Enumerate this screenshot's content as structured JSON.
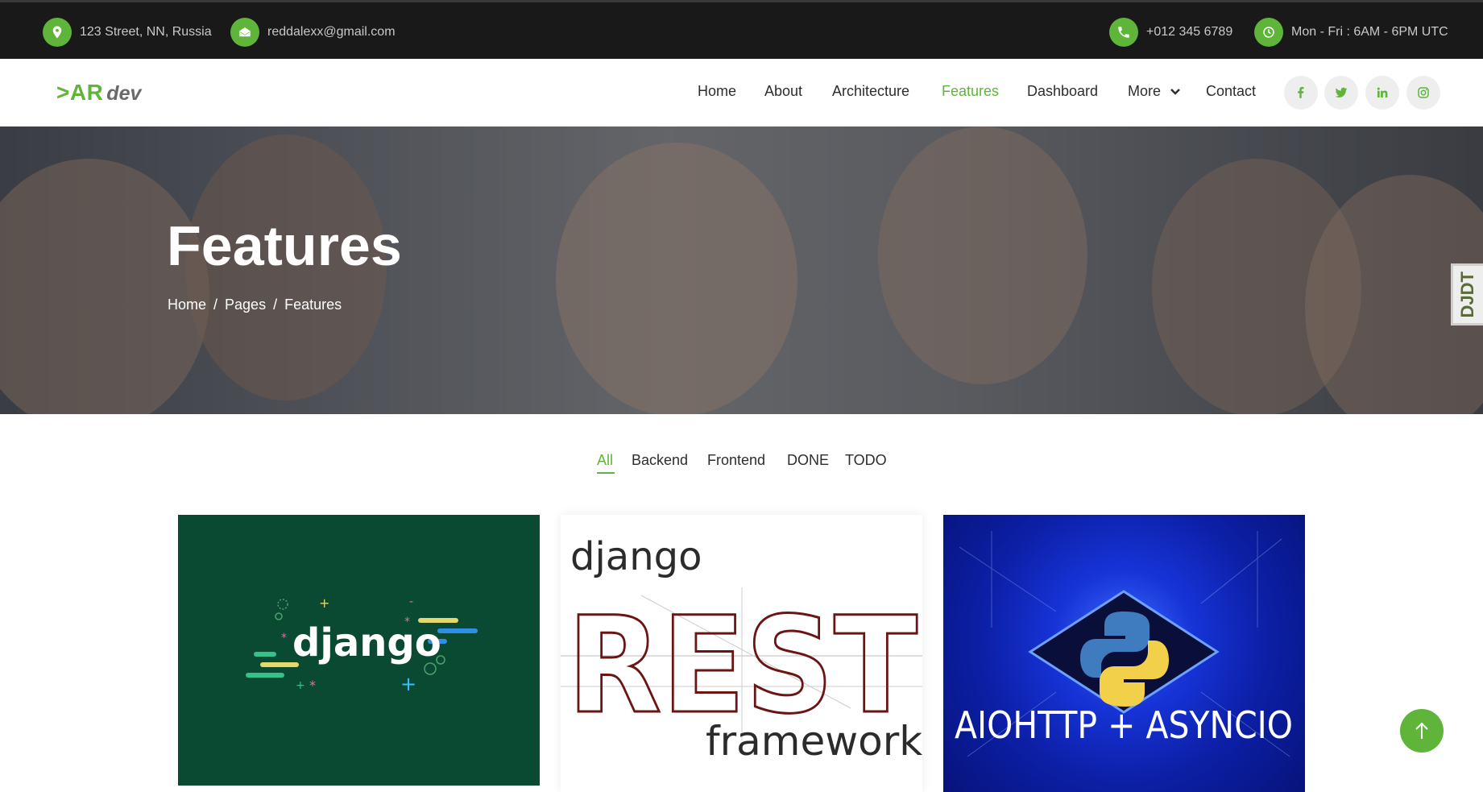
{
  "topbar": {
    "address": "123 Street, NN, Russia",
    "email": "reddalexx@gmail.com",
    "phone": "+012 345 6789",
    "hours": "Mon - Fri : 6AM - 6PM UTC"
  },
  "brand": {
    "prefix": ">AR",
    "suffix": "dev"
  },
  "nav": {
    "items": [
      "Home",
      "About",
      "Architecture",
      "Features",
      "Dashboard",
      "More",
      "Contact"
    ],
    "active": "Features"
  },
  "social": [
    "facebook-icon",
    "twitter-icon",
    "linkedin-icon",
    "instagram-icon"
  ],
  "hero": {
    "title": "Features",
    "breadcrumb": [
      "Home",
      "/",
      "Pages",
      "/",
      "Features"
    ]
  },
  "debug_toolbar": {
    "label": "DJDT"
  },
  "filters": {
    "items": [
      "All",
      "Backend",
      "Frontend",
      "DONE",
      "TODO"
    ],
    "active": "All"
  },
  "cards": [
    {
      "logo_text": "django"
    },
    {
      "top_text": "django",
      "big_text": "REST",
      "bottom_text": "framework"
    },
    {
      "caption": "AIOHTTP + ASYNCIO"
    }
  ],
  "colors": {
    "accent": "#5fb53a",
    "topbar_bg": "#191919",
    "text": "#2d2d2d"
  }
}
